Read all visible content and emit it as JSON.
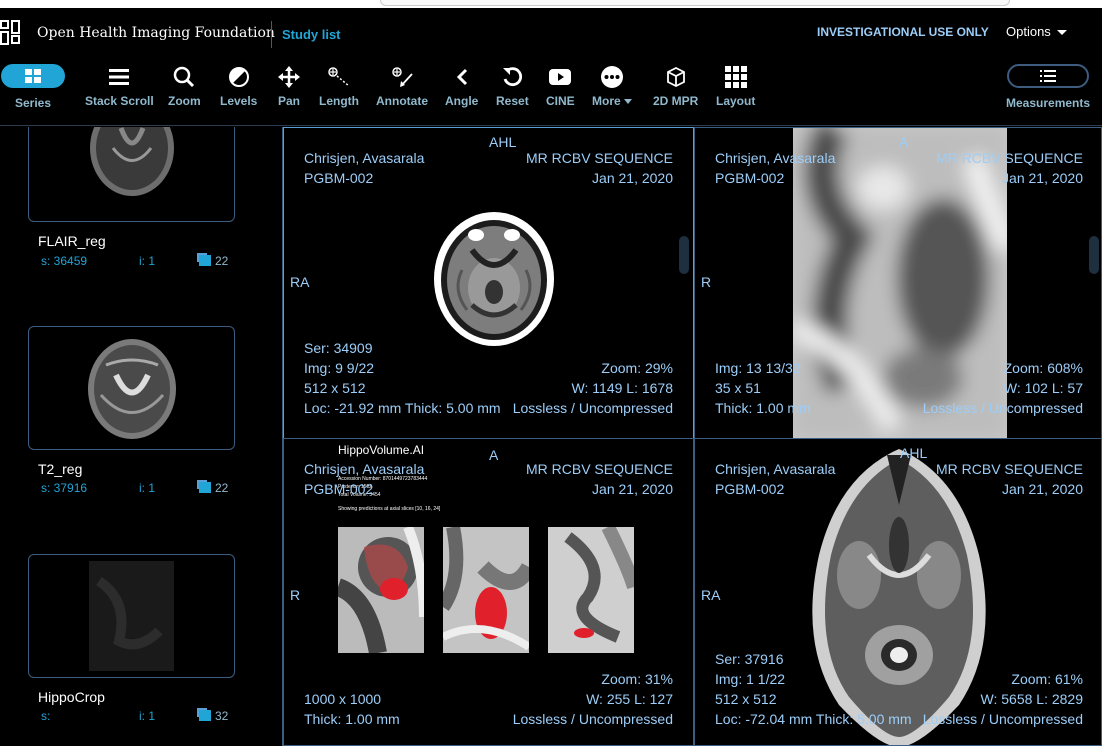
{
  "header": {
    "org_name": "Open Health Imaging Foundation",
    "study_list": "Study list",
    "investigational": "INVESTIGATIONAL USE ONLY",
    "options": "Options"
  },
  "toolbar": {
    "series": "Series",
    "stack_scroll": "Stack Scroll",
    "zoom": "Zoom",
    "levels": "Levels",
    "pan": "Pan",
    "length": "Length",
    "annotate": "Annotate",
    "angle": "Angle",
    "reset": "Reset",
    "cine": "CINE",
    "more": "More",
    "mpr": "2D MPR",
    "layout": "Layout",
    "measurements": "Measurements"
  },
  "series_list": [
    {
      "name": "FLAIR_reg",
      "series": "s: 36459",
      "instance": "i: 1",
      "frames": "22"
    },
    {
      "name": "T2_reg",
      "series": "s: 37916",
      "instance": "i: 1",
      "frames": "22"
    },
    {
      "name": "HippoCrop",
      "series": "s:",
      "instance": "i: 1",
      "frames": "32"
    }
  ],
  "viewports": [
    {
      "patient": "Chrisjen, Avasarala",
      "patient_id": "PGBM-002",
      "description": "MR RCBV SEQUENCE",
      "date": "Jan 21, 2020",
      "orient_top": "AHL",
      "orient_left": "RA",
      "bl1": "Ser: 34909",
      "bl2": "Img: 9 9/22",
      "bl3": "512 x 512",
      "bl4": "Loc: -21.92 mm Thick: 5.00 mm",
      "br1": "Zoom: 29%",
      "br2": "W: 1149 L: 1678",
      "br3": "Lossless / Uncompressed"
    },
    {
      "patient": "Chrisjen, Avasarala",
      "patient_id": "PGBM-002",
      "description": "MR RCBV SEQUENCE",
      "date": "Jan 21, 2020",
      "orient_top": "A",
      "orient_left": "R",
      "bl1": "Img: 13 13/32",
      "bl2": "35 x 51",
      "bl3": "Thick: 1.00 mm",
      "br1": "Zoom: 608%",
      "br2": "W: 102 L: 57",
      "br3": "Lossless / Uncompressed"
    },
    {
      "patient": "Chrisjen, Avasarala",
      "patient_id": "PGBM-002",
      "description": "MR RCBV SEQUENCE",
      "date": "Jan 21, 2020",
      "orient_top": "A",
      "orient_left": "R",
      "bl1": "1000 x 1000",
      "bl2": "Thick: 1.00 mm",
      "br1": "Zoom: 31%",
      "br2": "W: 255 L: 127",
      "br3": "Lossless / Uncompressed",
      "report": {
        "title": "HippoVolume.AI",
        "accession": "Accession Number: 8701449723783444",
        "posterior": "Posterior: 1502",
        "total": "Total Volume: 3454",
        "caption": "Showing predictions at axial slices [10, 16, 24]"
      }
    },
    {
      "patient": "Chrisjen, Avasarala",
      "patient_id": "PGBM-002",
      "description": "MR RCBV SEQUENCE",
      "date": "Jan 21, 2020",
      "orient_top": "AHL",
      "orient_left": "RA",
      "bl1": "Ser: 37916",
      "bl2": "Img: 1 1/22",
      "bl3": "512 x 512",
      "bl4": "Loc: -72.04 mm Thick: 5.00 mm",
      "br1": "Zoom: 61%",
      "br2": "W: 5658 L: 2829",
      "br3": "Lossless / Uncompressed"
    }
  ],
  "colors": {
    "accent": "#20a5d6",
    "overlay_text": "#9ccef9",
    "border": "#3c5d80",
    "segmentation": "#e0202a"
  }
}
